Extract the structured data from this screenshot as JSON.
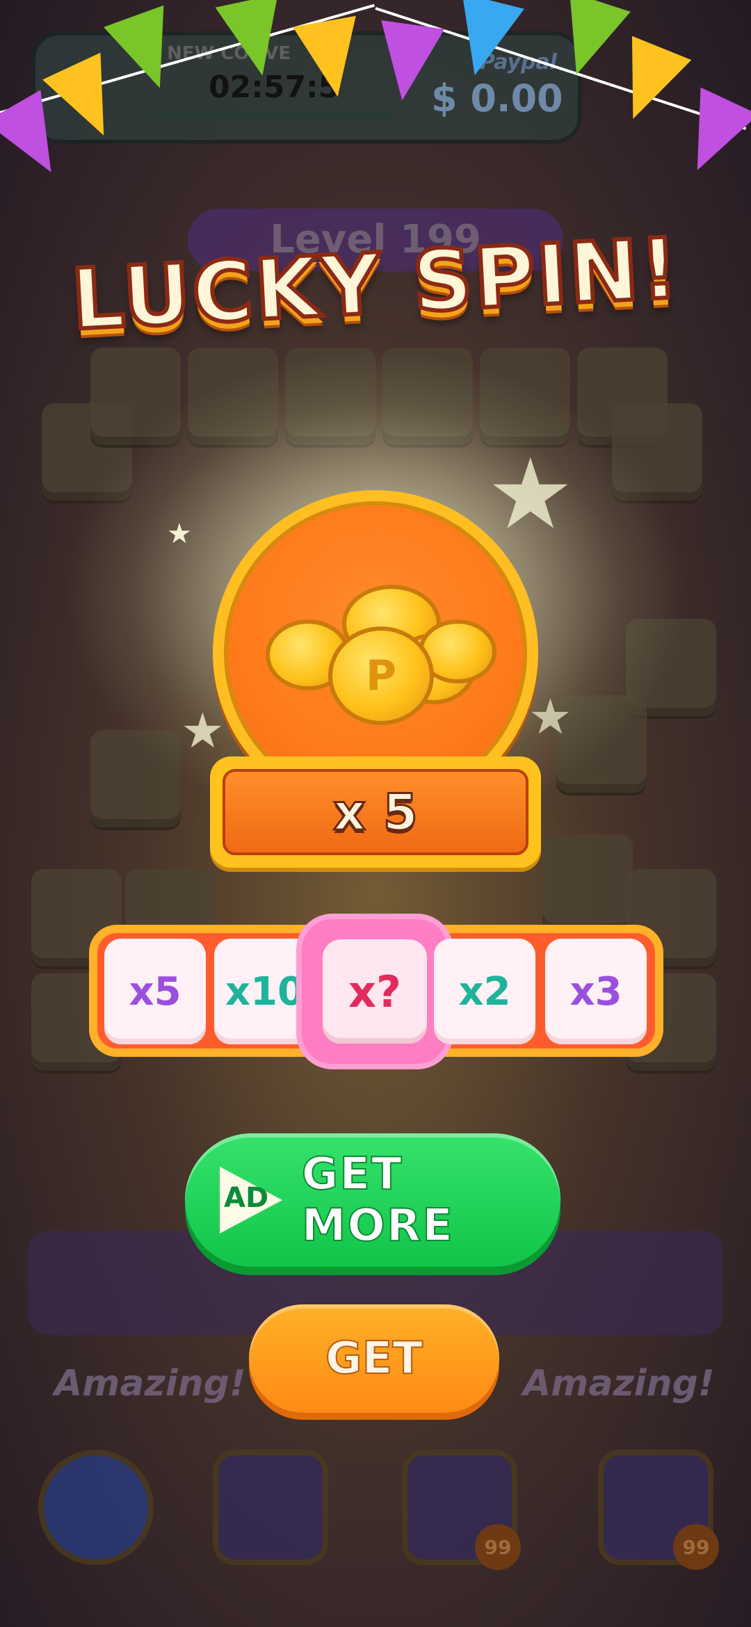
{
  "hud": {
    "timer_label": "NEW CONVE",
    "timer_value": "02:57:5",
    "paypal_label": "Paypal",
    "money": "$ 0.00"
  },
  "level_label": "Level 199",
  "popup": {
    "title": "LUCKY SPIN!",
    "reward_multiplier": "x 5",
    "spin_options": [
      {
        "label": "x5",
        "color": "#9b4fe0"
      },
      {
        "label": "x10",
        "color": "#1fb39a"
      },
      {
        "label": "x?",
        "color": "#e22a5c",
        "selected": true
      },
      {
        "label": "x2",
        "color": "#1fb39a"
      },
      {
        "label": "x3",
        "color": "#9b4fe0"
      }
    ],
    "get_more_button": {
      "ad_badge": "AD",
      "label": "GET MORE"
    },
    "get_button": "GET"
  },
  "background": {
    "amazing_left": "Amazing!",
    "amazing_right": "Amazing!",
    "badge_counts": [
      "99",
      "99"
    ]
  },
  "icons": [
    "settings-gear-icon",
    "undo-icon",
    "magic-wand-icon",
    "shuffle-icon",
    "ad-play-icon",
    "coin-pile-icon"
  ]
}
